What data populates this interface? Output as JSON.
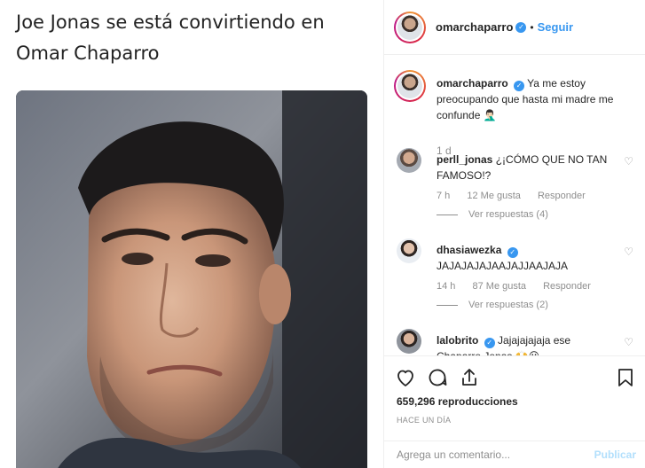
{
  "post": {
    "caption": "Joe Jonas se está convirtiendo en Omar Chaparro"
  },
  "header": {
    "username": "omarchaparro",
    "verified_icon": "verified-badge-icon",
    "separator": "•",
    "follow_label": "Seguir"
  },
  "owner_comment": {
    "username": "omarchaparro",
    "text": "Ya me estoy preocupando que hasta mi madre me confunde 🤦🏻‍♂️",
    "time": "1 d"
  },
  "comments": [
    {
      "username": "perll_jonas",
      "verified": false,
      "text": "¿¡CÓMO QUE NO TAN FAMOSO!?",
      "time": "7 h",
      "likes": "12 Me gusta",
      "reply_label": "Responder",
      "view_replies": "Ver respuestas (4)"
    },
    {
      "username": "dhasiawezka",
      "verified": true,
      "text": "JAJAJAJAJAAJAJJAAJAJA",
      "time": "14 h",
      "likes": "87 Me gusta",
      "reply_label": "Responder",
      "view_replies": "Ver respuestas (2)"
    },
    {
      "username": "lalobrito",
      "verified": true,
      "text": "Jajajajajaja ese Chaparro Jonas 🙌😮"
    }
  ],
  "actions": {
    "like_icon": "heart-icon",
    "comment_icon": "comment-bubble-icon",
    "share_icon": "share-icon",
    "save_icon": "bookmark-icon",
    "views": "659,296 reproducciones",
    "timestamp": "HACE UN DÍA"
  },
  "add_comment": {
    "placeholder": "Agrega un comentario...",
    "publish_label": "Publicar"
  },
  "colors": {
    "accent": "#3897f0",
    "muted": "#8e8e8e",
    "publish_disabled": "#b2dffc"
  }
}
